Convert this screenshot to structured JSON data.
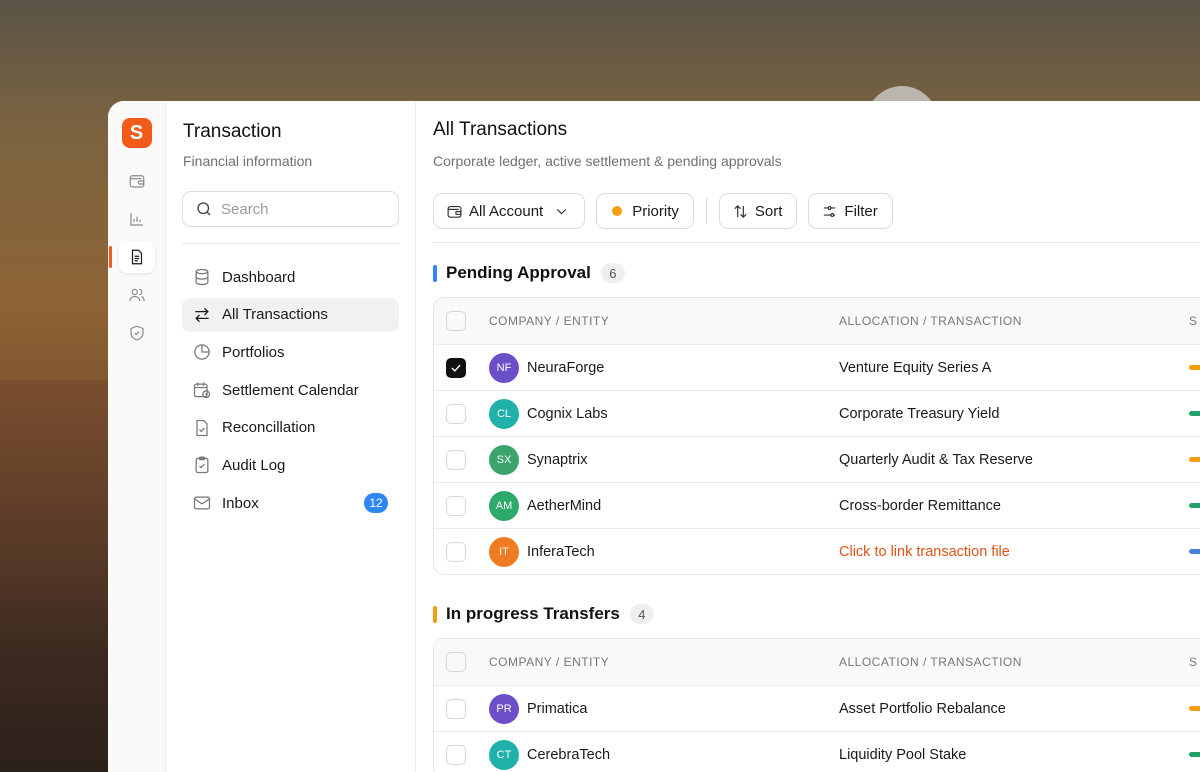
{
  "app": {
    "logo_letter": "S"
  },
  "rail": {
    "items": [
      {
        "icon": "wallet-icon",
        "active": false
      },
      {
        "icon": "chart-icon",
        "active": false
      },
      {
        "icon": "document-icon",
        "active": true
      },
      {
        "icon": "users-icon",
        "active": false
      },
      {
        "icon": "shield-icon",
        "active": false
      }
    ]
  },
  "sidebar": {
    "title": "Transaction",
    "subtitle": "Financial information",
    "search_placeholder": "Search",
    "items": [
      {
        "label": "Dashboard",
        "icon": "database-icon"
      },
      {
        "label": "All Transactions",
        "icon": "arrows-swap-icon",
        "active": true
      },
      {
        "label": "Portfolios",
        "icon": "pie-icon"
      },
      {
        "label": "Settlement Calendar",
        "icon": "calendar-clock-icon"
      },
      {
        "label": "Reconcillation",
        "icon": "file-check-icon"
      },
      {
        "label": "Audit Log",
        "icon": "clipboard-check-icon"
      },
      {
        "label": "Inbox",
        "icon": "mail-icon",
        "badge": "12"
      }
    ]
  },
  "main": {
    "title": "All Transactions",
    "subtitle": "Corporate ledger, active settlement & pending approvals",
    "toolbar": {
      "account_label": "All Account",
      "priority_label": "Priority",
      "sort_label": "Sort",
      "filter_label": "Filter"
    },
    "columns": {
      "entity": "COMPANY / ENTITY",
      "allocation": "ALLOCATION / TRANSACTION",
      "status": "S"
    },
    "sections": [
      {
        "name": "Pending Approval",
        "count": "6",
        "accent": "#2f86f6",
        "rows": [
          {
            "initials": "NF",
            "company": "NeuraForge",
            "allocation": "Venture Equity Series A",
            "avatar_color": "#6b4fc9",
            "status_color": "#f59e0b",
            "checked": true
          },
          {
            "initials": "CL",
            "company": "Cognix Labs",
            "allocation": "Corporate Treasury Yield",
            "avatar_color": "#20b2aa",
            "status_color": "#22a06b",
            "checked": false
          },
          {
            "initials": "SX",
            "company": "Synaptrix",
            "allocation": "Quarterly Audit & Tax Reserve",
            "avatar_color": "#3aa46a",
            "status_color": "#f59e0b",
            "checked": false
          },
          {
            "initials": "AM",
            "company": "AetherMind",
            "allocation": "Cross-border Remittance",
            "avatar_color": "#2faa6d",
            "status_color": "#22a06b",
            "checked": false
          },
          {
            "initials": "IT",
            "company": "InferaTech",
            "allocation": "Click to link transaction file",
            "avatar_color": "#ef7b22",
            "status_color": "#4a7fd6",
            "checked": false,
            "link": true
          }
        ]
      },
      {
        "name": "In progress Transfers",
        "count": "4",
        "accent": "#f59e0b",
        "rows": [
          {
            "initials": "PR",
            "company": "Primatica",
            "allocation": "Asset Portfolio Rebalance",
            "avatar_color": "#6b4fc9",
            "status_color": "#f59e0b",
            "checked": false
          },
          {
            "initials": "CT",
            "company": "CerebraTech",
            "allocation": "Liquidity Pool Stake",
            "avatar_color": "#20b2aa",
            "status_color": "#22a06b",
            "checked": false
          }
        ]
      }
    ]
  }
}
